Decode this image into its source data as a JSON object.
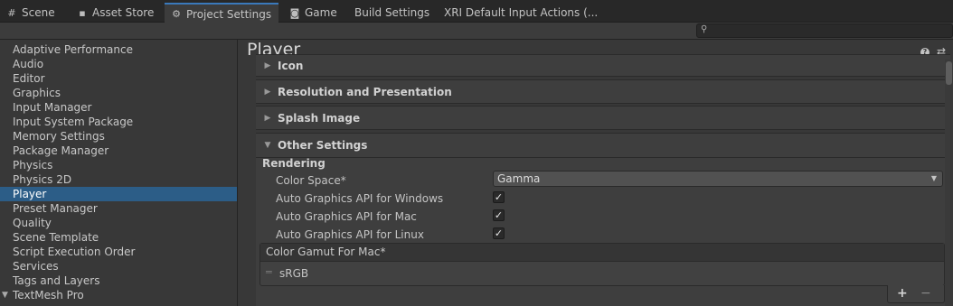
{
  "tabs": [
    {
      "label": "Scene",
      "icon": "grid-icon"
    },
    {
      "label": "Asset Store",
      "icon": "bag-icon"
    },
    {
      "label": "Project Settings",
      "icon": "gear-icon"
    },
    {
      "label": "Game",
      "icon": "gamepad-icon"
    },
    {
      "label": "Build Settings",
      "icon": ""
    },
    {
      "label": "XRI Default Input Actions (...",
      "icon": ""
    }
  ],
  "search": {
    "placeholder": ""
  },
  "sidebar": {
    "items": [
      {
        "label": "Adaptive Performance"
      },
      {
        "label": "Audio"
      },
      {
        "label": "Editor"
      },
      {
        "label": "Graphics"
      },
      {
        "label": "Input Manager"
      },
      {
        "label": "Input System Package"
      },
      {
        "label": "Memory Settings"
      },
      {
        "label": "Package Manager"
      },
      {
        "label": "Physics"
      },
      {
        "label": "Physics 2D"
      },
      {
        "label": "Player"
      },
      {
        "label": "Preset Manager"
      },
      {
        "label": "Quality"
      },
      {
        "label": "Scene Template"
      },
      {
        "label": "Script Execution Order"
      },
      {
        "label": "Services"
      },
      {
        "label": "Tags and Layers"
      },
      {
        "label": "TextMesh Pro"
      }
    ],
    "selected": "Player"
  },
  "main": {
    "title": "Player",
    "foldouts": [
      {
        "label": "Icon",
        "expanded": false
      },
      {
        "label": "Resolution and Presentation",
        "expanded": false
      },
      {
        "label": "Splash Image",
        "expanded": false
      },
      {
        "label": "Other Settings",
        "expanded": true
      }
    ],
    "rendering": {
      "section_label": "Rendering",
      "color_space_label": "Color Space*",
      "color_space_value": "Gamma",
      "auto_api_windows_label": "Auto Graphics API  for Windows",
      "auto_api_mac_label": "Auto Graphics API  for Mac",
      "auto_api_linux_label": "Auto Graphics API  for Linux",
      "auto_api_windows": true,
      "auto_api_mac": true,
      "auto_api_linux": true,
      "check_glyph": "✓",
      "gamut_header": "Color Gamut For Mac*",
      "gamut_items": [
        "sRGB"
      ],
      "add_label": "+",
      "remove_label": "−"
    }
  },
  "colors": {
    "accent": "#3a79bb",
    "selection": "#2c5d87",
    "background": "#383838"
  }
}
